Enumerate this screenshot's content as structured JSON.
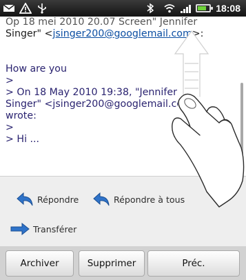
{
  "status_bar": {
    "time": "18:08",
    "icons": [
      "email-notification-icon",
      "warning-icon",
      "usb-icon",
      "bluetooth-icon",
      "wifi-icon",
      "signal-icon",
      "battery-icon"
    ]
  },
  "message": {
    "line1": "Op 18 mei 2010 20.07 Screen\" Jennifer",
    "line2_prefix": "Singer\" <",
    "line2_link": "jsinger200@googlemail.com",
    "line2_suffix": ">:",
    "greeting": "How are you",
    "quote_lines": [
      ">",
      "> On 18 May 2010 19:38, \"Jennifer",
      "Singer\" <jsinger200@googlemail.com>",
      "wrote:",
      ">",
      "> Hi ..."
    ]
  },
  "actions": {
    "reply": "Répondre",
    "reply_all": "Répondre à tous",
    "forward": "Transférer"
  },
  "buttons": {
    "archive": "Archiver",
    "delete": "Supprimer",
    "previous": "Préc."
  },
  "colors": {
    "accent_blue": "#2f73c9",
    "quote_text": "#2a2370",
    "link": "#0b4ea2"
  }
}
